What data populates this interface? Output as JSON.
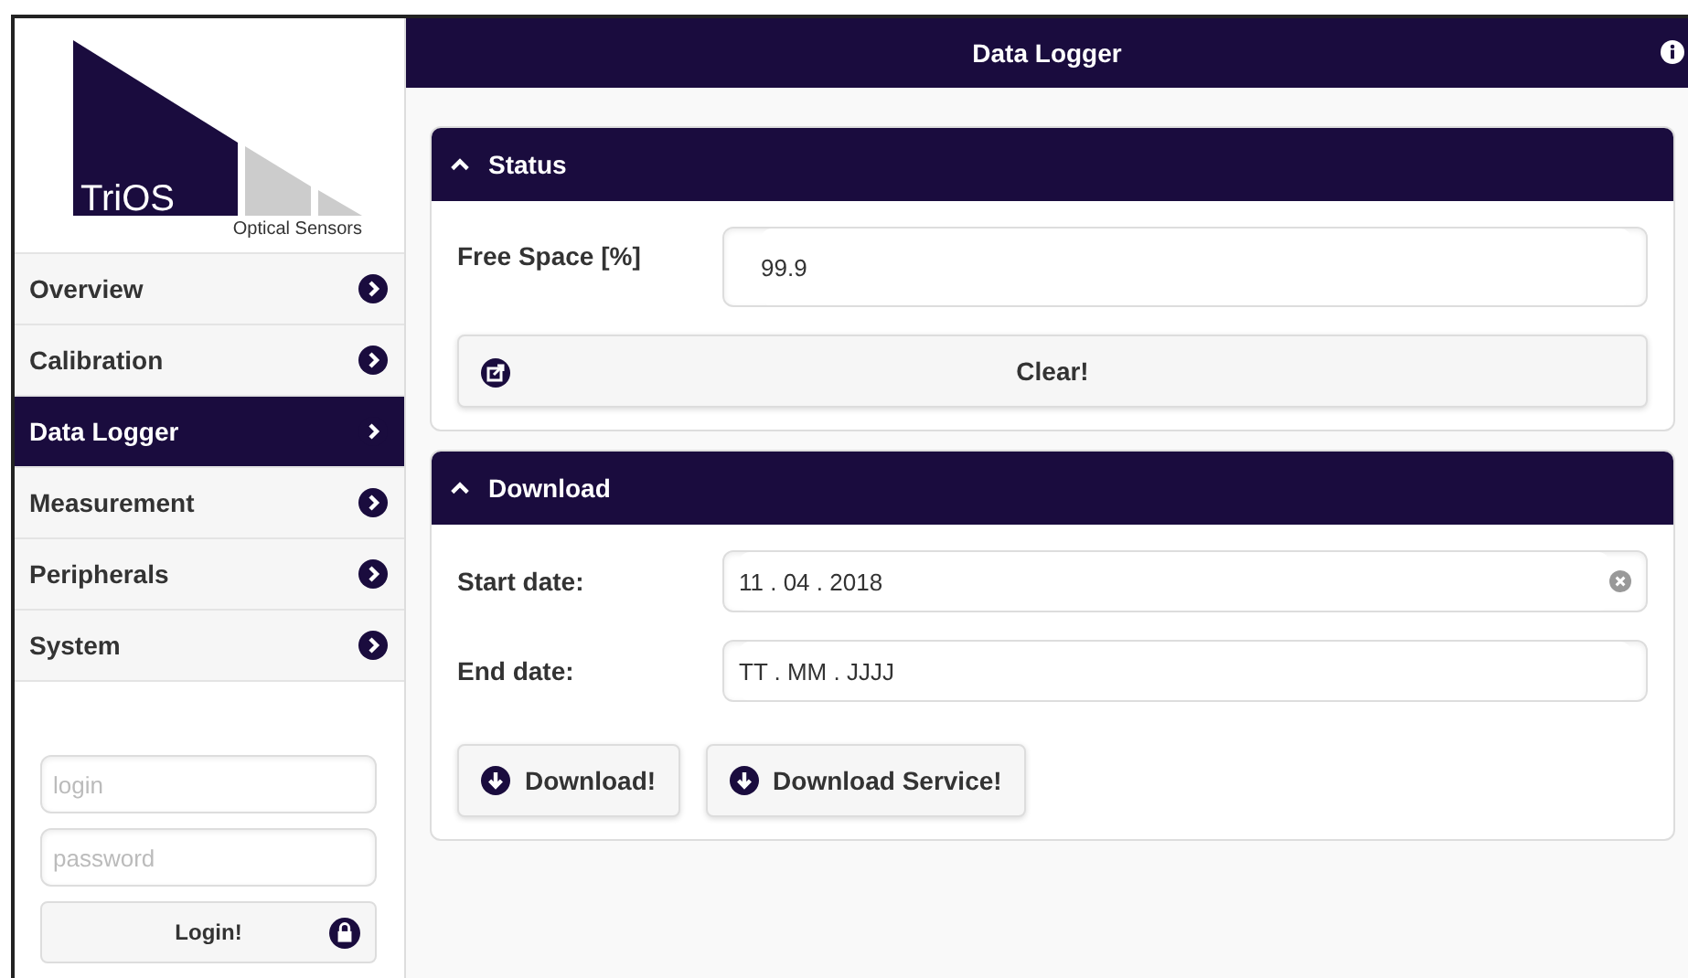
{
  "logo": {
    "name": "TriOS",
    "tagline": "Optical Sensors"
  },
  "nav": [
    {
      "label": "Overview",
      "selected": false
    },
    {
      "label": "Calibration",
      "selected": false
    },
    {
      "label": "Data Logger",
      "selected": true
    },
    {
      "label": "Measurement",
      "selected": false
    },
    {
      "label": "Peripherals",
      "selected": false
    },
    {
      "label": "System",
      "selected": false
    }
  ],
  "login": {
    "user": {
      "placeholder": "login"
    },
    "password": {
      "placeholder": "password"
    },
    "button": "Login!"
  },
  "header": {
    "title": "Data Logger"
  },
  "status": {
    "title": "Status",
    "expanded": true,
    "free_space": {
      "label": "Free Space [%]",
      "value": "99.9"
    },
    "clear_button": "Clear!"
  },
  "download": {
    "title": "Download",
    "expanded": true,
    "start_date": {
      "label": "Start date:",
      "value": "11 . 04 . 2018"
    },
    "end_date": {
      "label": "End date:",
      "placeholder": "TT . MM . JJJJ"
    },
    "buttons": [
      "Download!",
      "Download Service!"
    ]
  }
}
